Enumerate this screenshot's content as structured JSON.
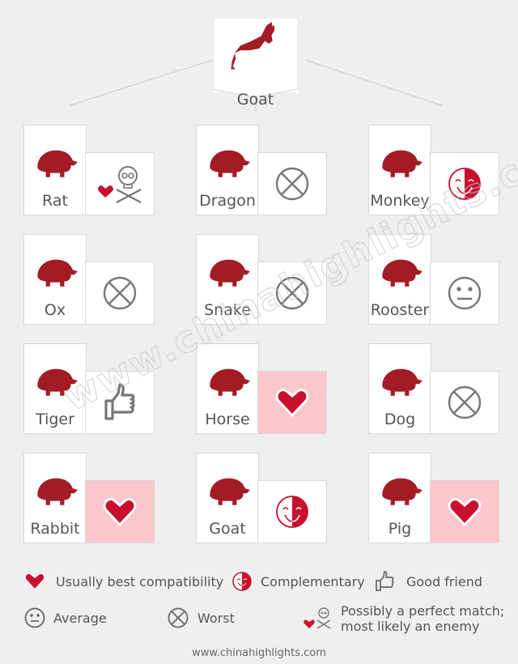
{
  "title_sign": {
    "name": "Goat",
    "icon": "goat-icon"
  },
  "colors": {
    "brand_red": "#a31b25",
    "heart_red": "#c8102e",
    "pink_bg": "#fec7ce",
    "gray_icon": "#777777",
    "background": "#efefef"
  },
  "signs": [
    {
      "name": "Rat",
      "animal_icon": "rat-icon",
      "relation": "love-hate"
    },
    {
      "name": "Dragon",
      "animal_icon": "dragon-icon",
      "relation": "worst"
    },
    {
      "name": "Monkey",
      "animal_icon": "monkey-icon",
      "relation": "complementary"
    },
    {
      "name": "Ox",
      "animal_icon": "ox-icon",
      "relation": "worst"
    },
    {
      "name": "Snake",
      "animal_icon": "snake-icon",
      "relation": "worst"
    },
    {
      "name": "Rooster",
      "animal_icon": "rooster-icon",
      "relation": "average"
    },
    {
      "name": "Tiger",
      "animal_icon": "tiger-icon",
      "relation": "good-friend"
    },
    {
      "name": "Horse",
      "animal_icon": "horse-icon",
      "relation": "best"
    },
    {
      "name": "Dog",
      "animal_icon": "dog-icon",
      "relation": "worst"
    },
    {
      "name": "Rabbit",
      "animal_icon": "rabbit-icon",
      "relation": "best"
    },
    {
      "name": "Goat",
      "animal_icon": "goat-icon",
      "relation": "complementary"
    },
    {
      "name": "Pig",
      "animal_icon": "pig-icon",
      "relation": "best"
    }
  ],
  "legend": {
    "best": "Usually best compatibility",
    "complementary": "Complementary",
    "good_friend": "Good friend",
    "average": "Average",
    "worst": "Worst",
    "love_hate_line1": "Possibly a perfect match;",
    "love_hate_line2": "most likely an enemy"
  },
  "watermark": "www.chinahighlights.com",
  "footer": "www.chinahighlights.com"
}
